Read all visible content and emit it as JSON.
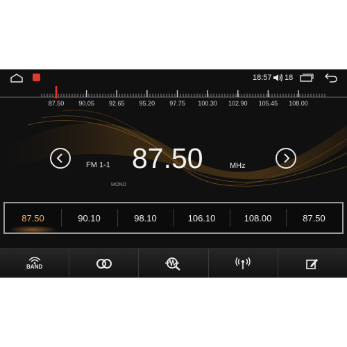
{
  "status_bar": {
    "time": "18:57",
    "volume_level": "18",
    "icons": [
      "home-icon",
      "app-icon",
      "volume-icon",
      "recent-apps-icon",
      "back-icon"
    ]
  },
  "tuning_scale": {
    "labels": [
      "87.50",
      "90.05",
      "92.65",
      "95.20",
      "97.75",
      "100.30",
      "102.90",
      "105.45",
      "108.00"
    ],
    "current_frequency": 87.5,
    "min": 87.5,
    "max": 108.0,
    "indicator_color": "#e2322a"
  },
  "tuner": {
    "band_label": "FM 1-1",
    "frequency": "87.50",
    "unit": "MHz",
    "mode": "MONO",
    "icons": [
      "chevron-left-icon",
      "chevron-right-icon"
    ]
  },
  "presets": {
    "items": [
      "87.50",
      "90.10",
      "98.10",
      "106.10",
      "108.00",
      "87.50"
    ],
    "active_index": 0,
    "active_color": "#f1b160"
  },
  "toolbar": {
    "band_label": "BAND",
    "icons": [
      "band-icon",
      "stereo-icon",
      "search-icon",
      "antenna-icon",
      "edit-icon"
    ]
  }
}
